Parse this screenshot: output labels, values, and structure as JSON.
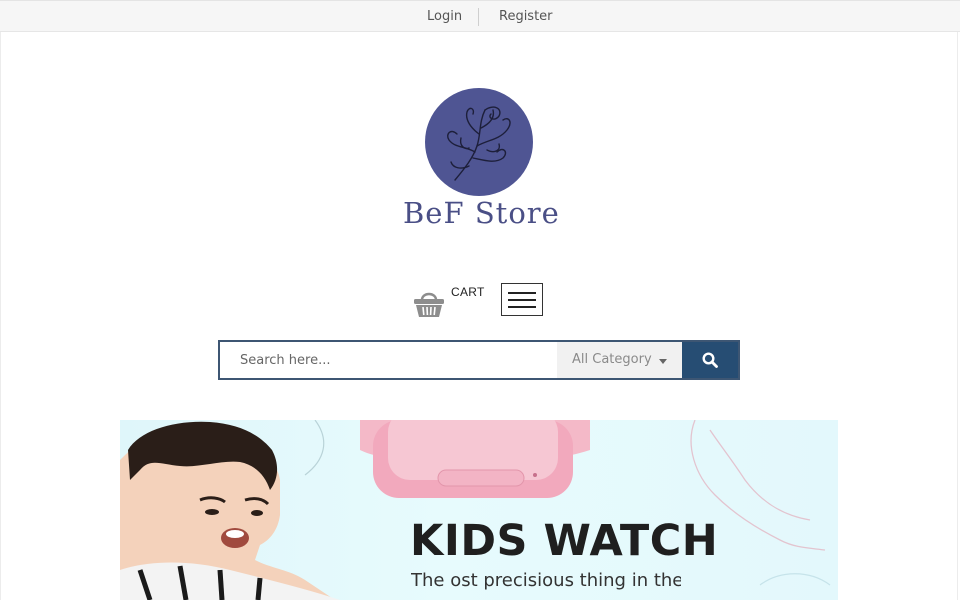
{
  "topbar": {
    "login": "Login",
    "register": "Register"
  },
  "logo": {
    "text": "BeF Store"
  },
  "cart": {
    "label": "CART"
  },
  "search": {
    "placeholder": "Search here...",
    "category": "All Category"
  },
  "banner": {
    "title": "KIDS WATCH",
    "subtitle": "The ost precisious thing in the w"
  },
  "colors": {
    "accent": "#264d73",
    "logo": "#4f5593",
    "banner_bg": "#e3f8fc"
  },
  "icons": {
    "cart": "basket-icon",
    "menu": "hamburger-icon",
    "search": "search-icon",
    "caret": "caret-down-icon"
  }
}
